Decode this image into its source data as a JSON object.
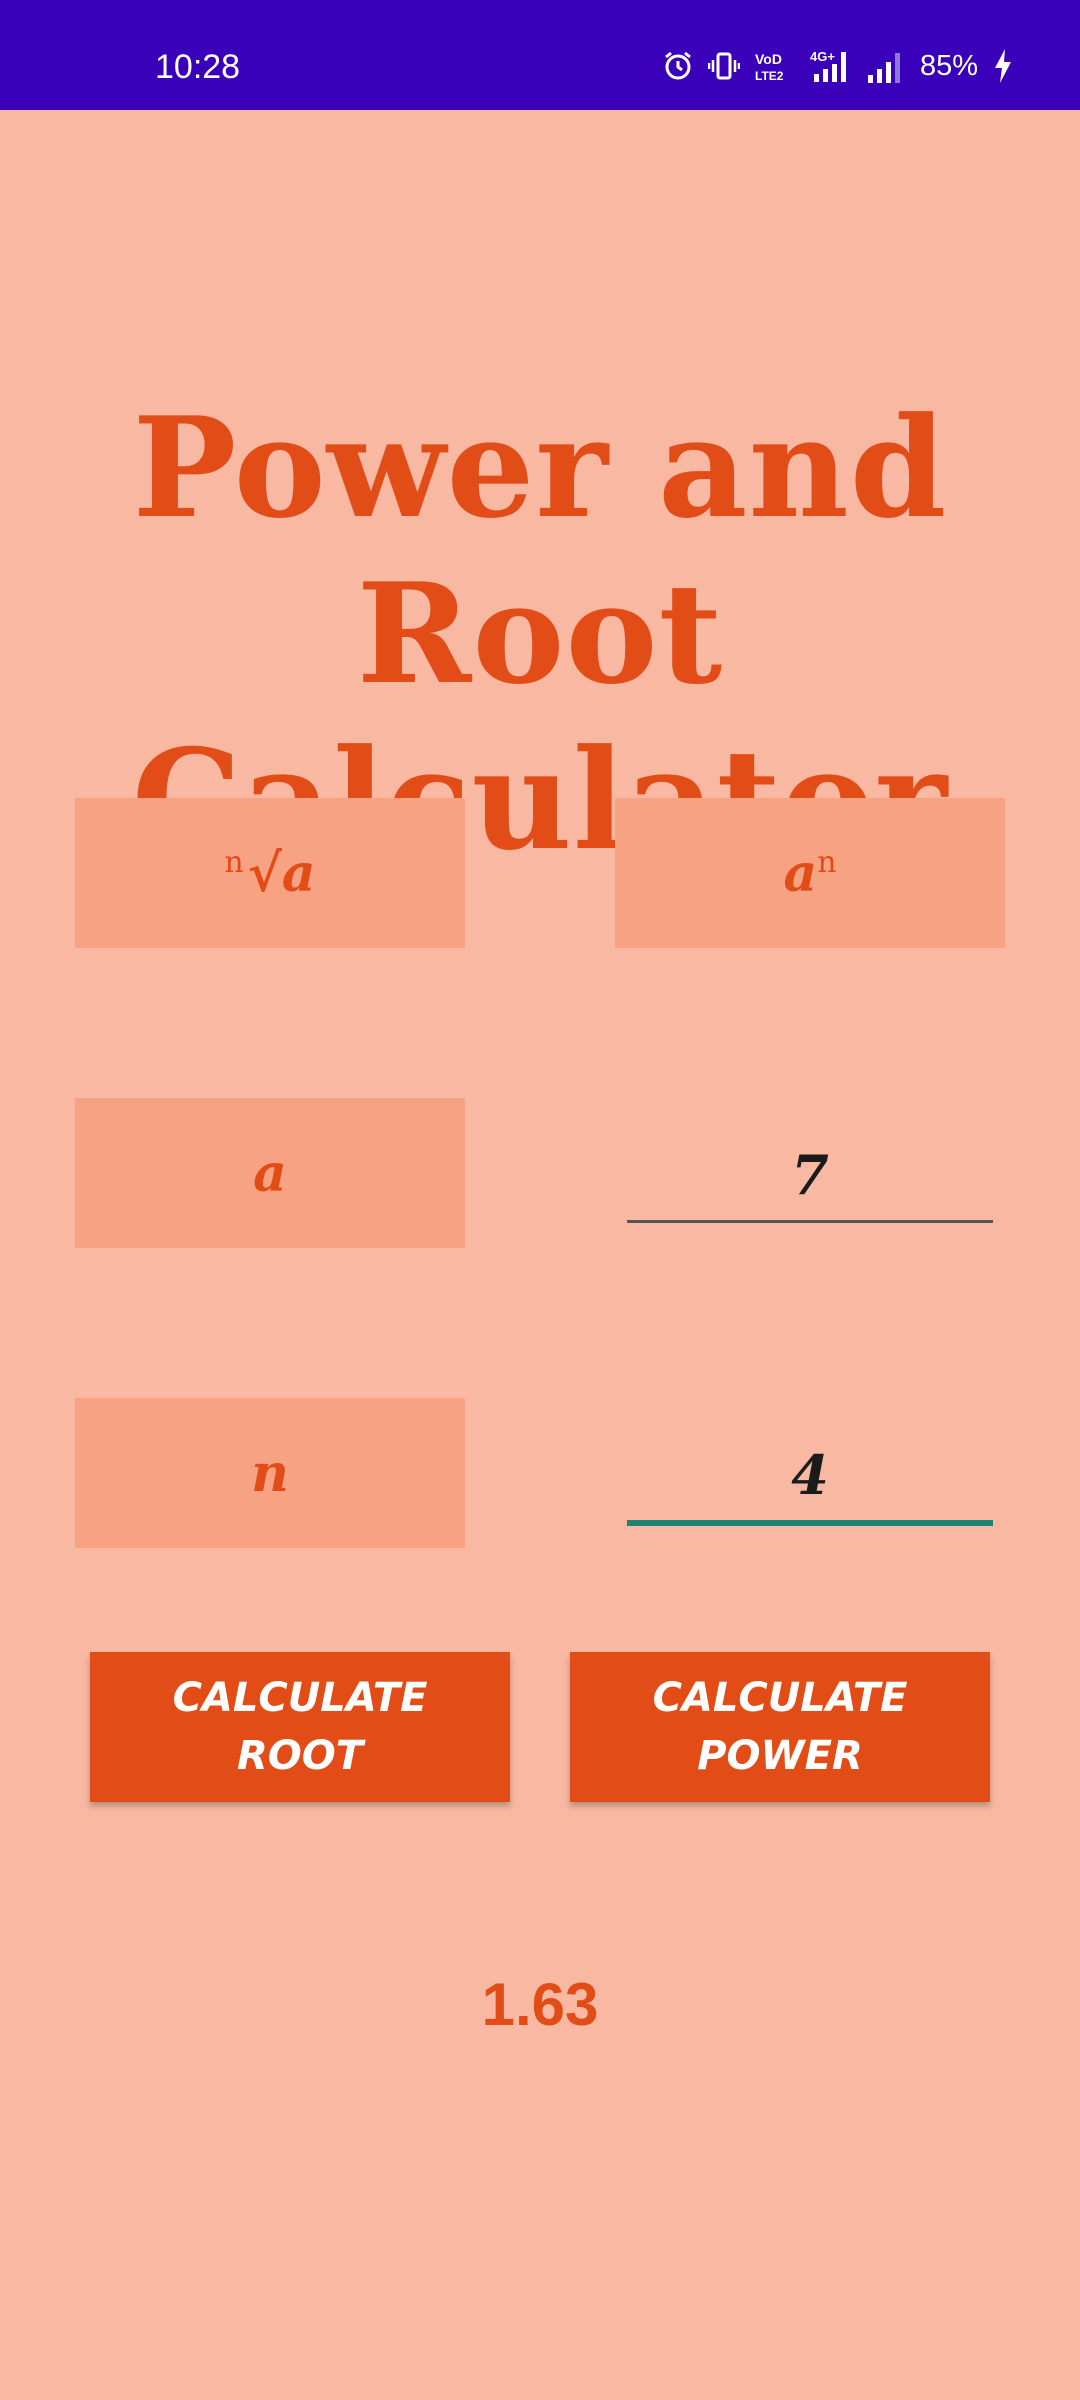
{
  "status_bar": {
    "time": "10:28",
    "battery": "85%",
    "icons": [
      "alarm-icon",
      "vibrate-icon",
      "volte-icon",
      "signal-4g-icon",
      "signal-icon",
      "battery-charging-icon"
    ]
  },
  "title": {
    "line1": "Power and Root",
    "line2": "Calculator"
  },
  "root_box": {
    "sup": "n",
    "radical": "√",
    "base": "a"
  },
  "power_box": {
    "base": "a",
    "sup": "n"
  },
  "label_a": "a",
  "label_n": "n",
  "input_a": {
    "value": "7"
  },
  "input_n": {
    "value": "4"
  },
  "buttons": {
    "root": "CALCULATE\nROOT",
    "power": "CALCULATE\nPOWER"
  },
  "result": "1.63",
  "colors": {
    "status_bar": "#3A00BA",
    "background": "#F8B8A2",
    "accent": "#E24C17",
    "label_box": "#F7A283",
    "focus_underline": "#1E8276"
  }
}
